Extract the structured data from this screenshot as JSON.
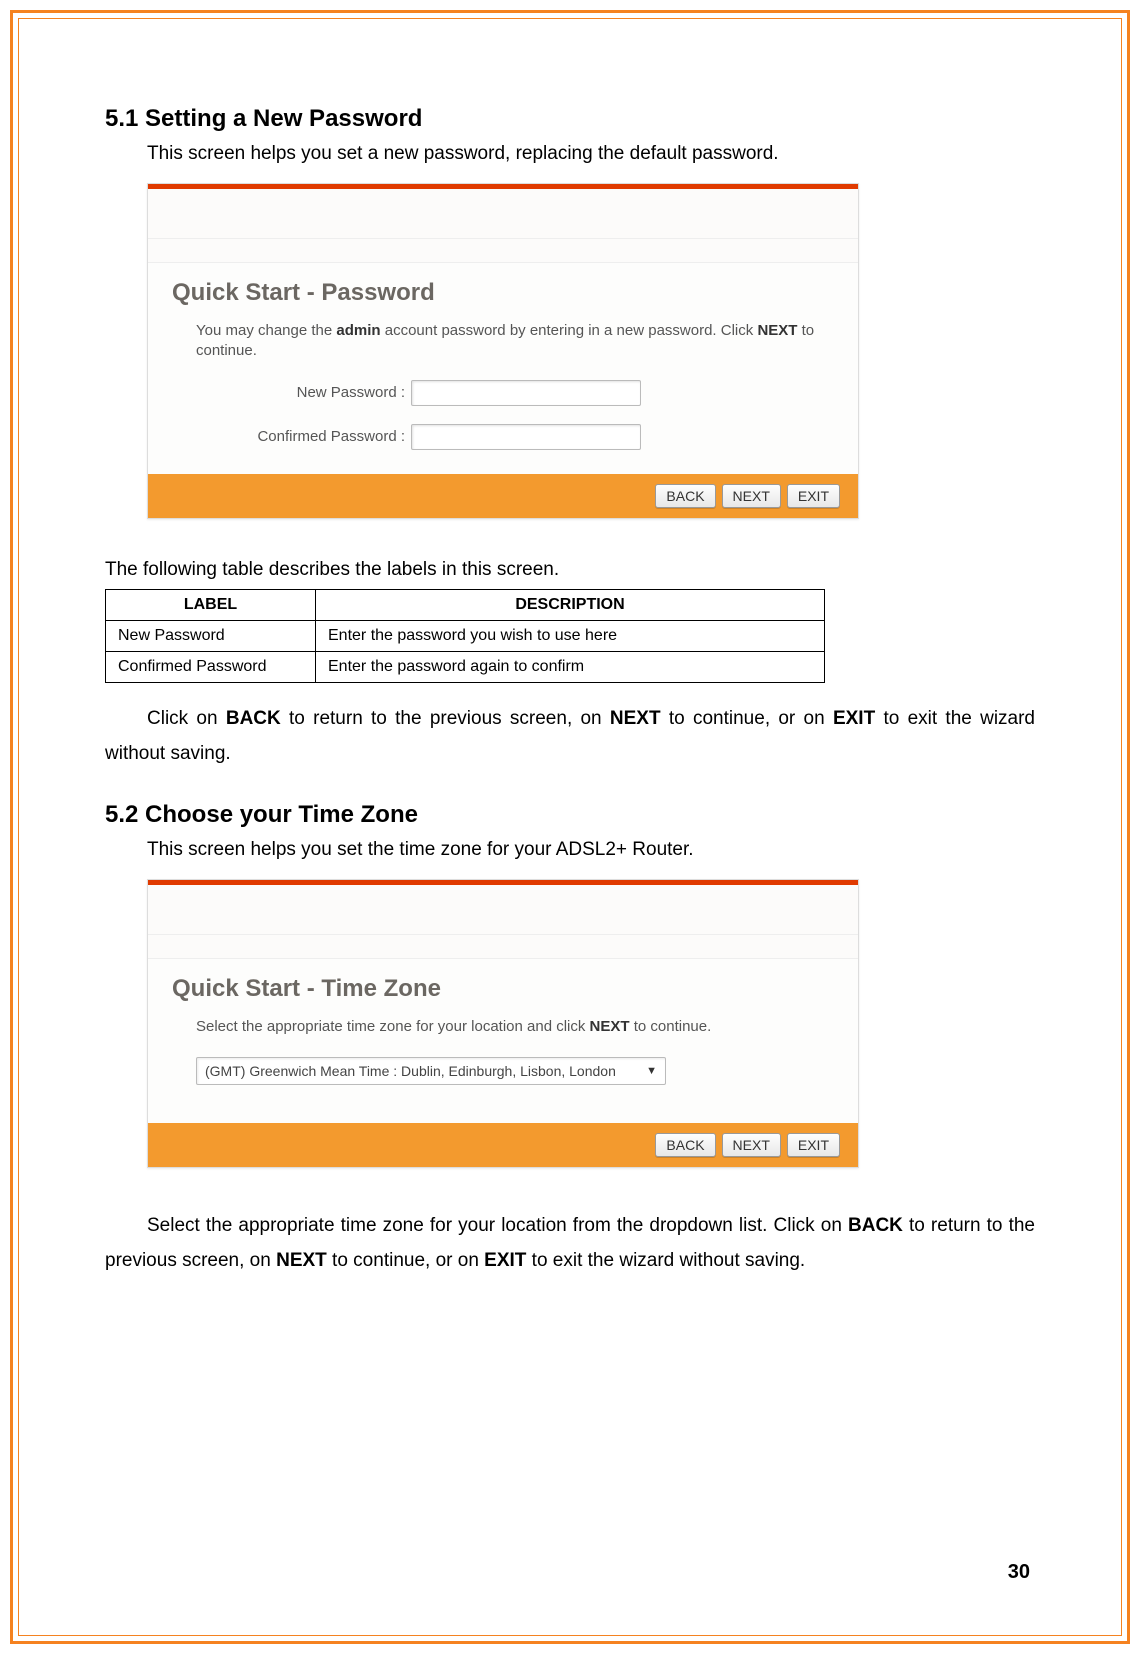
{
  "page_number": "30",
  "section1": {
    "heading": "5.1 Setting a New Password",
    "intro": "This screen helps you set a new password, replacing the default password.",
    "panel_title": "Quick Start - Password",
    "panel_desc_pre": "You may change the ",
    "panel_desc_bold1": "admin",
    "panel_desc_mid": " account password by entering in a new password. Click ",
    "panel_desc_bold2": "NEXT",
    "panel_desc_post": " to continue.",
    "label_new": "New Password :",
    "label_confirm": "Confirmed Password :",
    "btn_back": "BACK",
    "btn_next": "NEXT",
    "btn_exit": "EXIT",
    "table_intro": "The following table describes the labels in this screen.",
    "th_label": "LABEL",
    "th_desc": "DESCRIPTION",
    "row1_label": "New Password",
    "row1_desc": "Enter the password you wish to use here",
    "row2_label": "Confirmed Password",
    "row2_desc": "Enter the password again to confirm",
    "post_pre": "Click on ",
    "post_b1": "BACK",
    "post_mid1": " to return to the previous screen, on ",
    "post_b2": "NEXT",
    "post_mid2": " to continue, or on ",
    "post_b3": "EXIT",
    "post_end": " to exit the wizard without saving."
  },
  "section2": {
    "heading": "5.2 Choose your Time Zone",
    "intro": "This screen helps you set the time zone for your ADSL2+ Router.",
    "panel_title": "Quick Start - Time Zone",
    "panel_desc_pre": "Select the appropriate time zone for your location and click ",
    "panel_desc_bold": "NEXT",
    "panel_desc_post": " to continue.",
    "tz_value": "(GMT) Greenwich Mean Time : Dublin, Edinburgh, Lisbon, London",
    "btn_back": "BACK",
    "btn_next": "NEXT",
    "btn_exit": "EXIT",
    "post_pre": "Select the appropriate time zone for your location from the dropdown list. Click on ",
    "post_b1": "BACK",
    "post_mid1": " to return to the previous screen, on ",
    "post_b2": "NEXT",
    "post_mid2": " to continue, or on ",
    "post_b3": "EXIT",
    "post_end": " to exit the wizard without saving."
  }
}
